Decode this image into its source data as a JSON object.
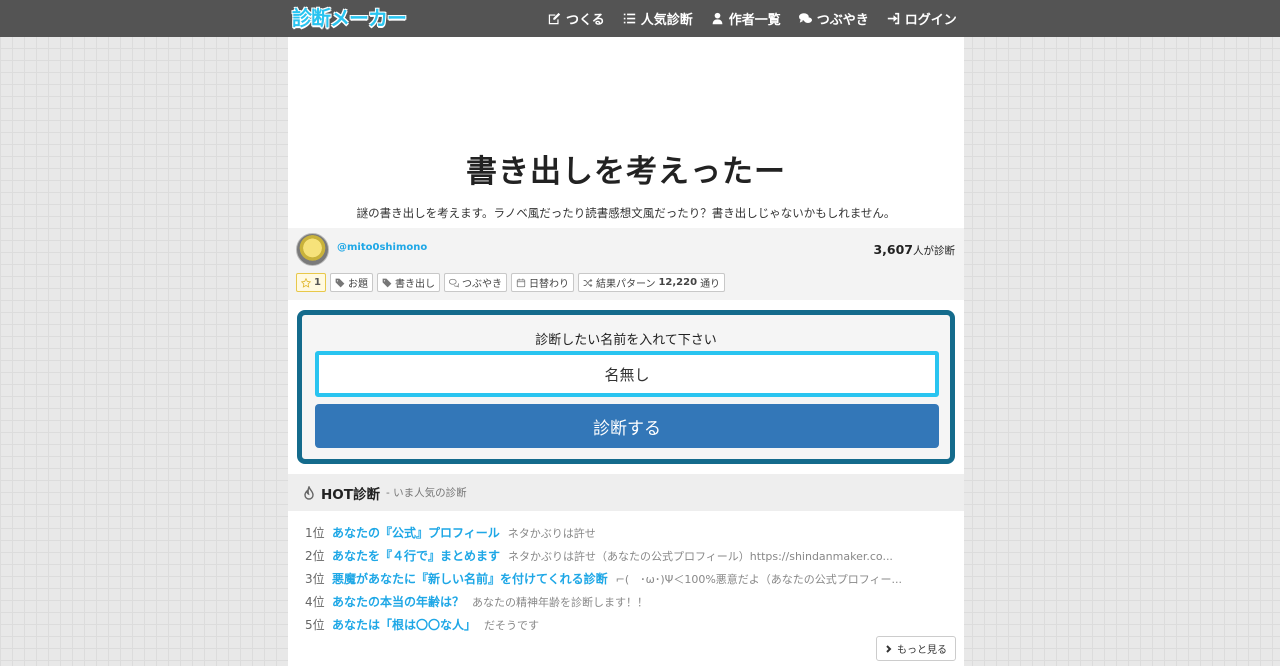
{
  "header": {
    "logo": "診断メーカー",
    "nav": [
      {
        "label": "つくる",
        "icon": "edit-icon"
      },
      {
        "label": "人気診断",
        "icon": "list-icon"
      },
      {
        "label": "作者一覧",
        "icon": "user-icon"
      },
      {
        "label": "つぶやき",
        "icon": "comments-icon"
      },
      {
        "label": "ログイン",
        "icon": "sign-in-icon"
      }
    ]
  },
  "diagnosis": {
    "title": "書き出しを考えったー",
    "description": "謎の書き出しを考えます。ラノベ風だったり読書感想文風だったり？書き出しじゃないかもしれません。",
    "author": "@mito0shimono",
    "count": "3,607",
    "count_unit": "人が診断",
    "tags": {
      "star_count": "1",
      "tag1": "お題",
      "tag2": "書き出し",
      "tweets": "つぶやき",
      "daily": "日替わり",
      "patterns_label": "結果パターン",
      "patterns_count": "12,220",
      "patterns_unit": "通り"
    }
  },
  "form": {
    "label": "診断したい名前を入れて下さい",
    "input_value": "名無し",
    "submit_label": "診断する"
  },
  "hot": {
    "title": "HOT診断",
    "subtitle": "- いま人気の診断",
    "items": [
      {
        "rank": "1位",
        "title": "あなたの『公式』プロフィール",
        "desc": "ネタかぶりは許せ"
      },
      {
        "rank": "2位",
        "title": "あなたを『４行で』まとめます",
        "desc": "ネタかぶりは許せ（あなたの公式プロフィール）https://shindanmaker.co..."
      },
      {
        "rank": "3位",
        "title": "悪魔があなたに『新しい名前』を付けてくれる診断",
        "desc": "⌐(　･ω･)Ψ＜100%悪意だよ（あなたの公式プロフィー..."
      },
      {
        "rank": "4位",
        "title": "あなたの本当の年齢は？",
        "desc": "あなたの精神年齢を診断します！！"
      },
      {
        "rank": "5位",
        "title": "あなたは「根は〇〇な人」",
        "desc": "だそうです"
      }
    ],
    "more_label": "もっと見る"
  },
  "colors": {
    "accent": "#29c4f0",
    "button": "#3377b8",
    "form_border": "#146b8c",
    "navbar": "#545454"
  }
}
